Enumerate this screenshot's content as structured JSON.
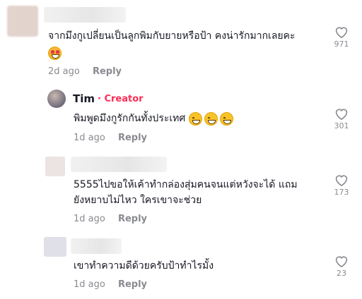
{
  "comments": [
    {
      "text": "จากมึงกูเปลี่ยนเป็นลูกพิมกับยายหรือป้า คงน่ารักมากเลยคะ",
      "emoji": "smiling-face-with-hearts",
      "age": "2d ago",
      "reply_label": "Reply",
      "likes": "971"
    },
    {
      "author": "Tim",
      "badge": "Creator",
      "badge_separator": "·",
      "text": "พิมพูดมึงกูรักกันทั้งประเทศ",
      "emoji": "grinning-sweat x3",
      "age": "1d ago",
      "reply_label": "Reply",
      "likes": "301"
    },
    {
      "text_line1": "5555ไปขอให้เค้าทำกล่องสุ่มคนจนแต่หวังจะได้ แถม",
      "text_line2": "ยังหยาบไม่ไหว ใครเขาจะช่วย",
      "age": "1d ago",
      "reply_label": "Reply",
      "likes": "173"
    },
    {
      "text": "เขาทำความดีด้วยครับป้าทำไรมั้ง",
      "age": "1d ago",
      "reply_label": "Reply",
      "likes": "23"
    }
  ],
  "colors": {
    "creator_badge": "#fe2c55",
    "meta": "#8a8b91",
    "text": "#161823"
  }
}
